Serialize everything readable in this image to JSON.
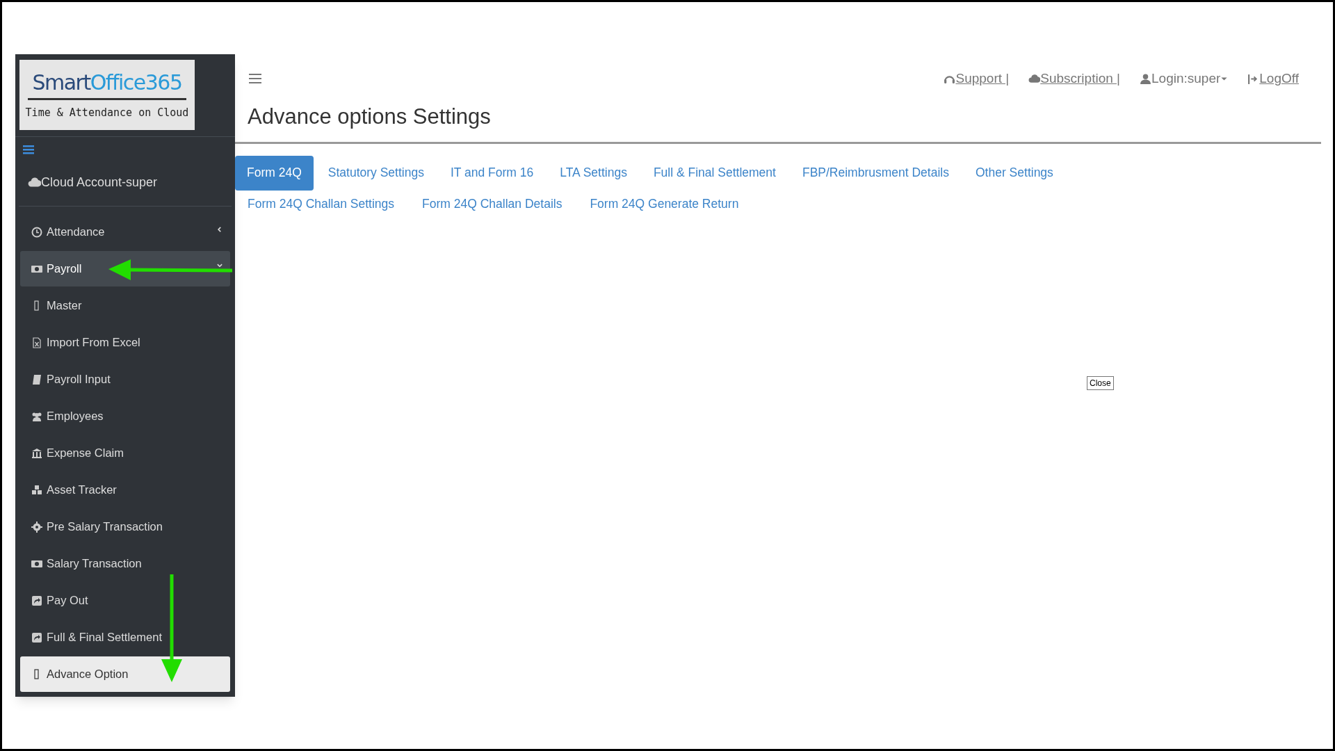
{
  "logo": {
    "title": "SmartOffice365",
    "tagline": "Time & Attendance on Cloud"
  },
  "account": "Cloud Account-super",
  "menu": [
    {
      "label": "Attendance",
      "expanded": false
    },
    {
      "label": "Payroll",
      "expanded": true,
      "children": [
        {
          "label": "Master",
          "selected": false
        },
        {
          "label": "Import From Excel",
          "selected": false
        },
        {
          "label": "Payroll Input",
          "selected": false
        },
        {
          "label": "Employees",
          "selected": false
        },
        {
          "label": "Expense Claim",
          "selected": false
        },
        {
          "label": "Asset Tracker",
          "selected": false
        },
        {
          "label": "Pre Salary Transaction",
          "selected": false
        },
        {
          "label": "Salary Transaction",
          "selected": false
        },
        {
          "label": "Pay Out",
          "selected": false
        },
        {
          "label": "Full & Final Settlement",
          "selected": false
        },
        {
          "label": "Advance Option",
          "selected": true
        }
      ]
    }
  ],
  "top_links": [
    {
      "label": "Support |"
    },
    {
      "label": "Subscription |"
    },
    {
      "label": "Login:super"
    },
    {
      "label": "LogOff"
    }
  ],
  "page_title": "Advance options Settings",
  "tabs": [
    {
      "label": "Form 24Q",
      "selected": true
    },
    {
      "label": "Statutory Settings",
      "selected": false
    },
    {
      "label": "IT and Form 16",
      "selected": false
    },
    {
      "label": "LTA Settings",
      "selected": false
    },
    {
      "label": "Full & Final Settlement",
      "selected": false
    },
    {
      "label": "FBP/Reimbrusment Details",
      "selected": false
    },
    {
      "label": "Other Settings",
      "selected": false
    }
  ],
  "subtabs": [
    {
      "label": "Form 24Q Challan Settings"
    },
    {
      "label": "Form 24Q Challan Details"
    },
    {
      "label": "Form 24Q Generate Return"
    }
  ],
  "close_button": "Close"
}
